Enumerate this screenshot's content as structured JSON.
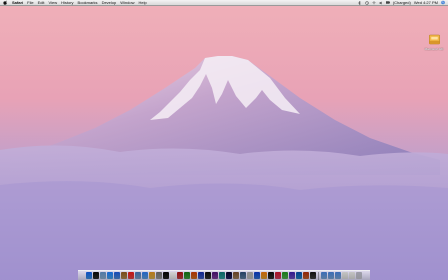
{
  "menubar": {
    "app_name": "Safari",
    "items": [
      "File",
      "Edit",
      "View",
      "History",
      "Bookmarks",
      "Develop",
      "Window",
      "Help"
    ],
    "status": {
      "battery": "(Charged)",
      "clock": "Wed 4:27 PM"
    }
  },
  "desktop": {
    "drive_label": "Macintosh HD"
  },
  "dock": {
    "apps": [
      {
        "name": "finder-icon",
        "color": "#3b8fe0"
      },
      {
        "name": "dashboard-icon",
        "color": "#2b2b2b"
      },
      {
        "name": "mail-icon",
        "color": "#8fb0d0"
      },
      {
        "name": "safari-icon",
        "color": "#4aa3e8"
      },
      {
        "name": "ichat-icon",
        "color": "#4c8ad8"
      },
      {
        "name": "address-book-icon",
        "color": "#b08a50"
      },
      {
        "name": "ical-icon",
        "color": "#e04848"
      },
      {
        "name": "preview-icon",
        "color": "#7aa0c8"
      },
      {
        "name": "itunes-icon",
        "color": "#5fa0e0"
      },
      {
        "name": "photo-icon",
        "color": "#d8b050"
      },
      {
        "name": "system-preferences-icon",
        "color": "#9a9a9a"
      },
      {
        "name": "terminal-icon",
        "color": "#222222"
      },
      {
        "name": "textedit-icon",
        "color": "#e8e8e8"
      },
      {
        "name": "app-icon",
        "color": "#c04040"
      },
      {
        "name": "app-icon",
        "color": "#40a040"
      },
      {
        "name": "app-icon",
        "color": "#d07020"
      },
      {
        "name": "app-icon",
        "color": "#4060c0"
      },
      {
        "name": "app-icon",
        "color": "#303030"
      },
      {
        "name": "app-icon",
        "color": "#8040a0"
      },
      {
        "name": "app-icon",
        "color": "#30a0a0"
      },
      {
        "name": "app-icon",
        "color": "#202060"
      },
      {
        "name": "app-icon",
        "color": "#a08060"
      },
      {
        "name": "app-icon",
        "color": "#6080a0"
      },
      {
        "name": "app-icon",
        "color": "#c0c0c0"
      },
      {
        "name": "app-icon",
        "color": "#3070d0"
      },
      {
        "name": "app-icon",
        "color": "#e0a030"
      },
      {
        "name": "app-icon",
        "color": "#303030"
      },
      {
        "name": "app-icon",
        "color": "#d04060"
      },
      {
        "name": "app-icon",
        "color": "#50b050"
      },
      {
        "name": "app-icon",
        "color": "#7050c0"
      },
      {
        "name": "app-icon",
        "color": "#2080c0"
      },
      {
        "name": "app-icon",
        "color": "#c06030"
      },
      {
        "name": "app-icon",
        "color": "#404040"
      }
    ],
    "right": [
      {
        "name": "folder-icon",
        "color": "#7aa6d8"
      },
      {
        "name": "folder-icon",
        "color": "#7aa6d8"
      },
      {
        "name": "folder-icon",
        "color": "#7aa6d8"
      },
      {
        "name": "stack-icon",
        "color": "#e0e0e0"
      },
      {
        "name": "stack-icon",
        "color": "#e0e0e0"
      },
      {
        "name": "trash-icon",
        "color": "#c8c8d0"
      }
    ]
  }
}
